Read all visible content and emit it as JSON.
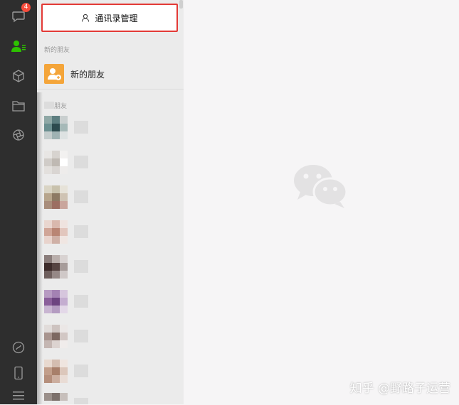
{
  "nav": {
    "chat_badge": "4",
    "icons": [
      "chat-icon",
      "contacts-icon",
      "cube-icon",
      "folder-icon",
      "settings-icon",
      "mini-program-icon",
      "phone-icon",
      "menu-icon"
    ]
  },
  "contacts": {
    "manage_button_label": "通讯录管理",
    "new_friends_section": "新的朋友",
    "new_friends_item": "新的朋友",
    "friends_section": "朋友"
  },
  "watermark": "知乎 @野路子运营",
  "colors": {
    "nav_bg": "#2e2e2e",
    "active_green": "#2dc100",
    "badge_red": "#f74c3c",
    "highlight_red": "#e33a36",
    "new_friend_orange": "#f4a53a"
  }
}
